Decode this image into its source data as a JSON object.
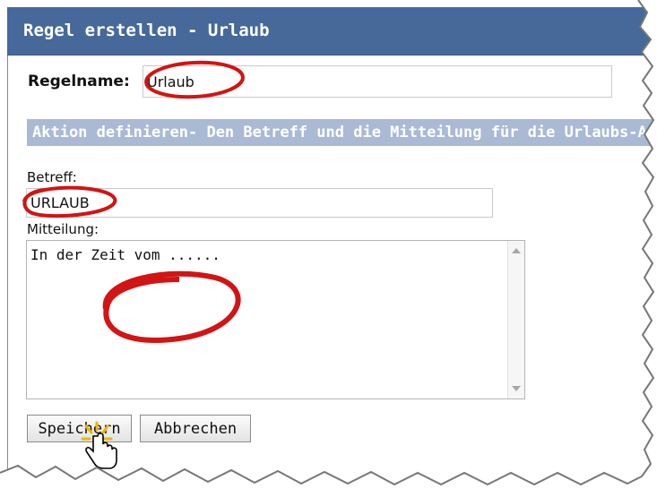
{
  "dialog": {
    "title": "Regel erstellen - Urlaub",
    "rule_name_label": "Regelname:",
    "rule_name_value": "Urlaub",
    "section_header": "Aktion definieren- Den Betreff und die Mitteilung für die Urlaubs-Ant",
    "subject_label": "Betreff:",
    "subject_value": "URLAUB",
    "message_label": "Mitteilung:",
    "message_value": "In der Zeit vom ......",
    "save_button": "Speichern",
    "cancel_button": "Abbrechen"
  },
  "colors": {
    "title_bar": "#46699a",
    "section_bar": "#aab9d4",
    "annotation_red": "#d21414"
  },
  "icons": [
    "scroll-up-arrow-icon",
    "scroll-down-arrow-icon",
    "hand-cursor-icon"
  ]
}
